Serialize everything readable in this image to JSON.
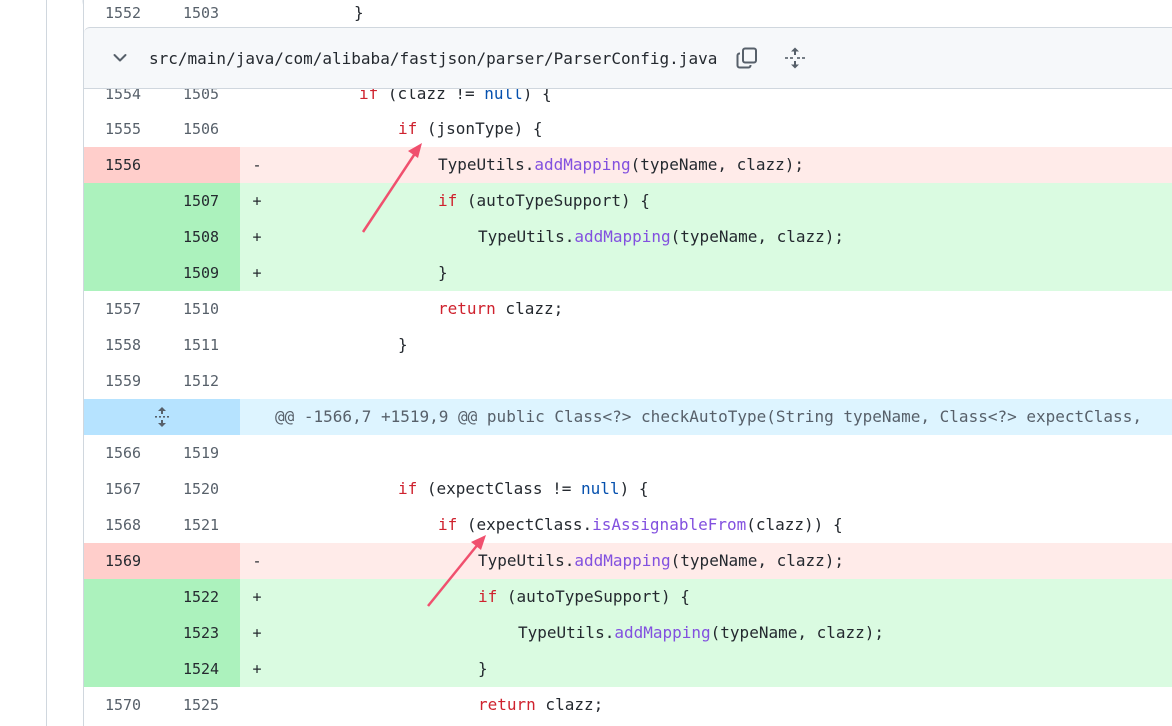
{
  "file": {
    "path": "src/main/java/com/alibaba/fastjson/parser/ParserConfig.java",
    "icons": {
      "collapse": "chevron-down-icon",
      "copy": "copy-icon",
      "expand": "unfold-icon"
    }
  },
  "partial_top_row": {
    "old": "1552",
    "new": "1503",
    "code": "}"
  },
  "hunk_header": "@@ -1566,7 +1519,9 @@ public Class<?> checkAutoType(String typeName, Class<?> expectClass,",
  "rows": [
    {
      "old": "1554",
      "new": "1505",
      "sign": "",
      "type": "context",
      "code": "if (clazz != null) {"
    },
    {
      "old": "1555",
      "new": "1506",
      "sign": "",
      "type": "context",
      "code": "if (jsonType) {"
    },
    {
      "old": "1556",
      "new": "",
      "sign": "-",
      "type": "del",
      "code": "TypeUtils.addMapping(typeName, clazz);"
    },
    {
      "old": "",
      "new": "1507",
      "sign": "+",
      "type": "add",
      "code": "if (autoTypeSupport) {"
    },
    {
      "old": "",
      "new": "1508",
      "sign": "+",
      "type": "add",
      "code": "TypeUtils.addMapping(typeName, clazz);"
    },
    {
      "old": "",
      "new": "1509",
      "sign": "+",
      "type": "add",
      "code": "}"
    },
    {
      "old": "1557",
      "new": "1510",
      "sign": "",
      "type": "context",
      "code": "return clazz;"
    },
    {
      "old": "1558",
      "new": "1511",
      "sign": "",
      "type": "context",
      "code": "}"
    },
    {
      "old": "1559",
      "new": "1512",
      "sign": "",
      "type": "context",
      "code": ""
    },
    {
      "old": "1566",
      "new": "1519",
      "sign": "",
      "type": "context",
      "code": ""
    },
    {
      "old": "1567",
      "new": "1520",
      "sign": "",
      "type": "context",
      "code": "if (expectClass != null) {"
    },
    {
      "old": "1568",
      "new": "1521",
      "sign": "",
      "type": "context",
      "code": "if (expectClass.isAssignableFrom(clazz)) {"
    },
    {
      "old": "1569",
      "new": "",
      "sign": "-",
      "type": "del",
      "code": "TypeUtils.addMapping(typeName, clazz);"
    },
    {
      "old": "",
      "new": "1522",
      "sign": "+",
      "type": "add",
      "code": "if (autoTypeSupport) {"
    },
    {
      "old": "",
      "new": "1523",
      "sign": "+",
      "type": "add",
      "code": "TypeUtils.addMapping(typeName, clazz);"
    },
    {
      "old": "",
      "new": "1524",
      "sign": "+",
      "type": "add",
      "code": "}"
    },
    {
      "old": "1570",
      "new": "1525",
      "sign": "",
      "type": "context",
      "code": "return clazz;"
    }
  ],
  "colors": {
    "deletion_bg": "#ffebe9",
    "deletion_gutter": "#ffcecb",
    "addition_bg": "#dafbe1",
    "addition_gutter": "#acf2bd",
    "hunk_bg": "#ddf4ff",
    "keyword": "#cf222e",
    "function": "#8250df",
    "literal": "#0550ae",
    "annotation_arrow": "#f0506e"
  }
}
